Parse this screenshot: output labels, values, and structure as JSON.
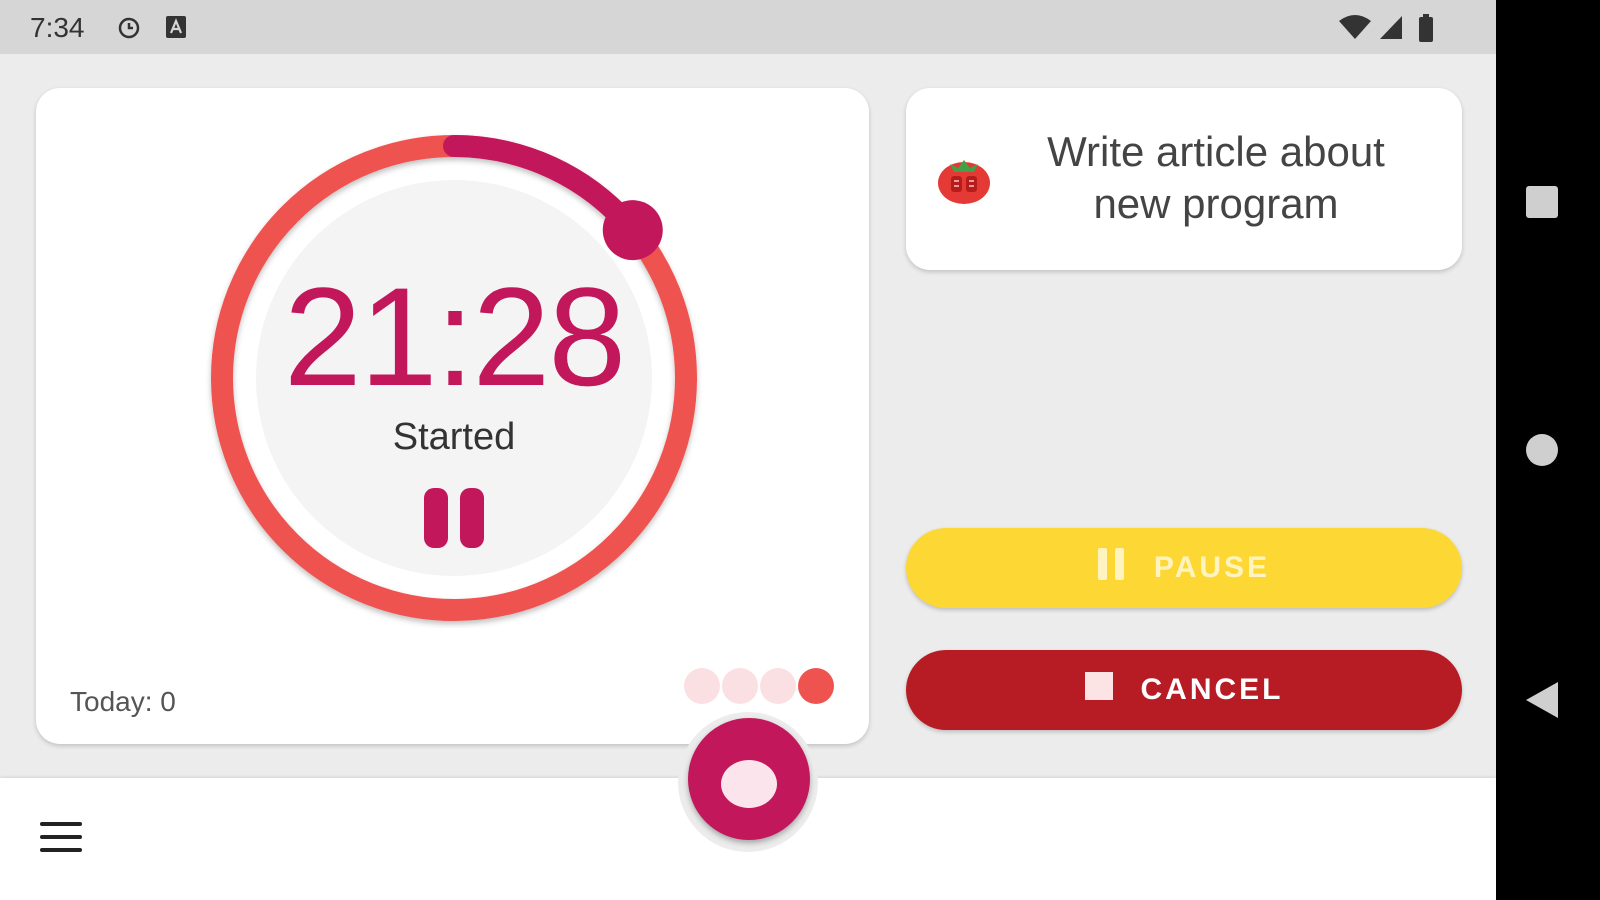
{
  "status_bar": {
    "time": "7:34",
    "icons": [
      "alarm-icon",
      "a-notification-icon",
      "wifi-icon",
      "signal-icon",
      "battery-icon"
    ]
  },
  "timer": {
    "time": "21:28",
    "state": "Started",
    "progress": 0.14,
    "today_label": "Today: 0",
    "session_dots": {
      "total": 4,
      "active_index": 3
    }
  },
  "task": {
    "title": "Write article about new program",
    "icon": "tomato-icon"
  },
  "buttons": {
    "pause_label": "PAUSE",
    "cancel_label": "CANCEL"
  },
  "colors": {
    "accent": "#c2185b",
    "ring": "#ef5350",
    "pause_button": "#fdd835",
    "cancel_button": "#b71c25",
    "dot_inactive": "#fbe0e3",
    "dot_active": "#ef5350"
  },
  "nav": [
    "menu-icon",
    "tomato-fab-icon"
  ],
  "system_nav": [
    "recents-button",
    "home-button",
    "back-button"
  ]
}
